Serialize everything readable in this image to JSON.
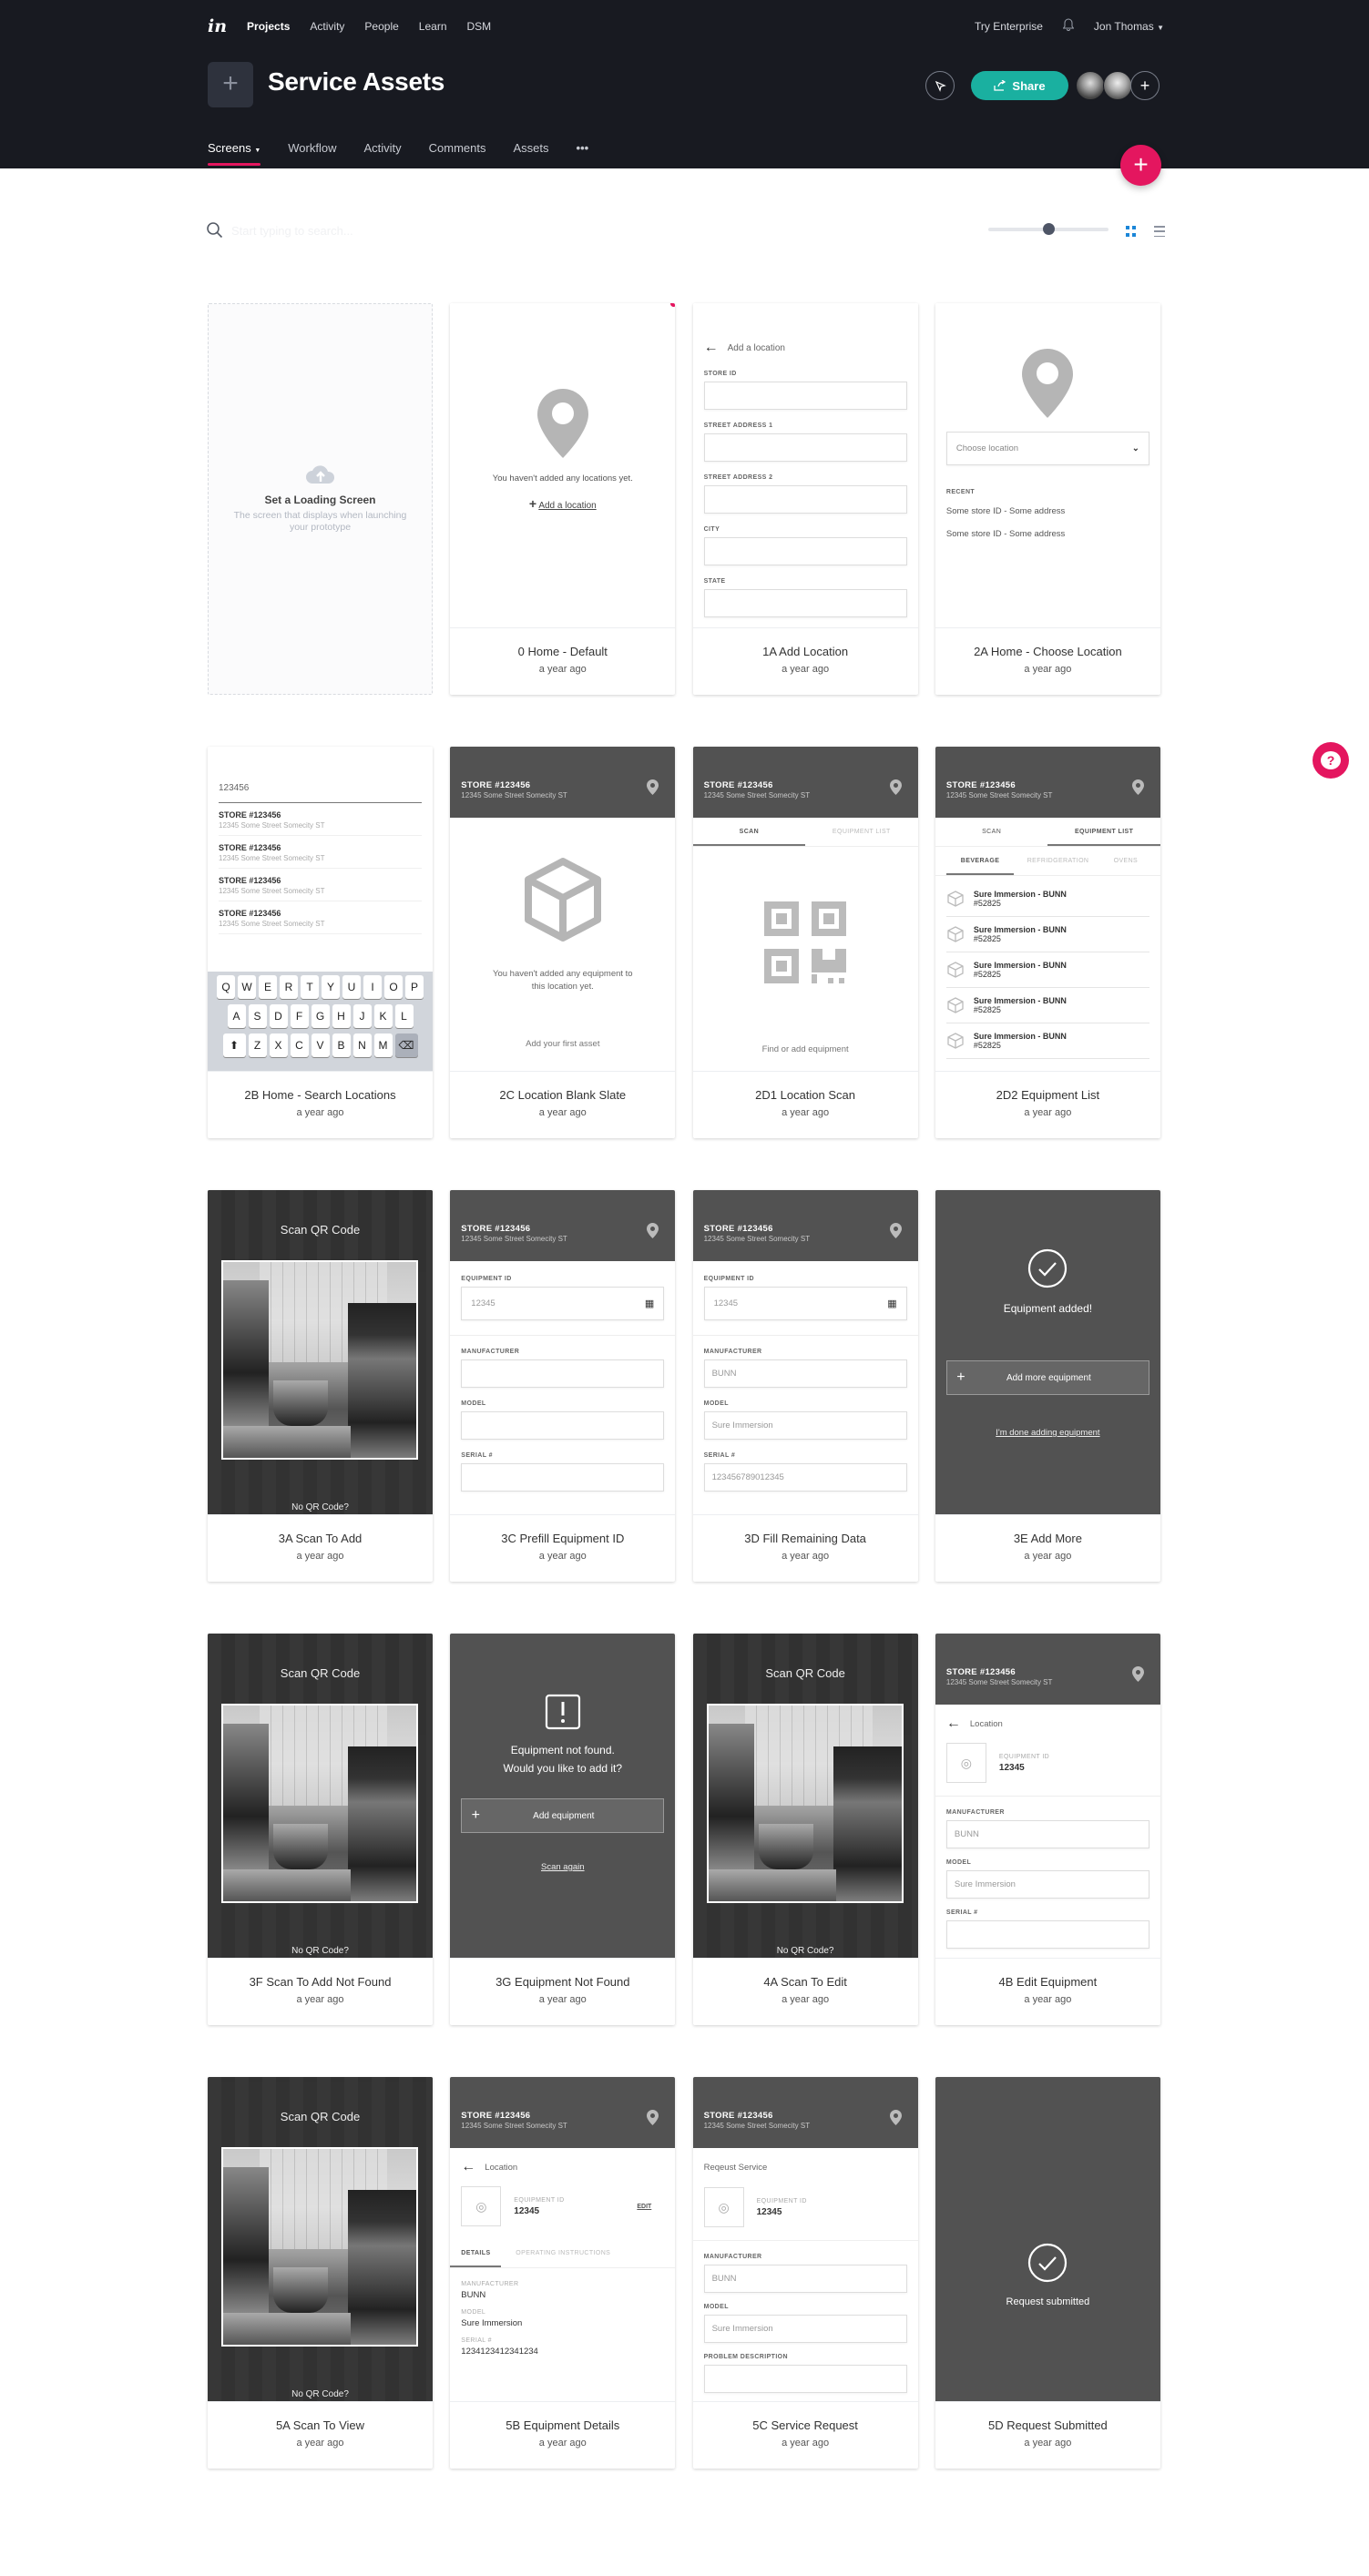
{
  "topnav": {
    "logo": "in",
    "items": [
      "Projects",
      "Activity",
      "People",
      "Learn",
      "DSM"
    ],
    "active": "Projects",
    "try_enterprise": "Try Enterprise",
    "user_name": "Jon Thomas"
  },
  "project": {
    "title": "Service Assets",
    "share_label": "Share"
  },
  "subnav": {
    "tabs": [
      "Screens",
      "Workflow",
      "Activity",
      "Comments",
      "Assets"
    ],
    "more": "•••"
  },
  "toolbar": {
    "search_placeholder": "Start typing to search...",
    "zoom_level": 0.5
  },
  "colors": {
    "accent": "#e4165f",
    "share": "#1ab0a0",
    "header_bg": "#181a21",
    "mock_dark": "#525252"
  },
  "loading_card": {
    "title": "Set a Loading Screen",
    "description": "The screen that displays when launching your prototype"
  },
  "common": {
    "time": "a year ago",
    "store_name": "STORE #123456",
    "store_address": "12345 Some Street Somecity ST",
    "scan_title": "Scan QR Code",
    "no_qr": "No QR Code?",
    "equipment_id_label": "EQUIPMENT ID",
    "equipment_id": "12345",
    "manufacturer_label": "MANUFACTURER",
    "model_label": "MODEL",
    "serial_label": "SERIAL #",
    "manufacturer": "BUNN",
    "model": "Sure Immersion"
  },
  "screens": [
    {
      "name": "0 Home - Default",
      "empty_text": "You haven't added any locations yet.",
      "link": "Add a location"
    },
    {
      "name": "1A Add Location",
      "back_label": "Add a location",
      "fields": [
        "STORE ID",
        "STREET ADDRESS 1",
        "STREET ADDRESS 2",
        "CITY",
        "STATE"
      ]
    },
    {
      "name": "2A Home - Choose Location",
      "select_placeholder": "Choose location",
      "recent_label": "RECENT",
      "recent": [
        "Some store ID - Some address",
        "Some store ID - Some address"
      ]
    },
    {
      "name": "2B Home - Search Locations",
      "query": "123456",
      "keyboard": [
        [
          "Q",
          "W",
          "E",
          "R",
          "T",
          "Y",
          "U",
          "I",
          "O",
          "P"
        ],
        [
          "A",
          "S",
          "D",
          "F",
          "G",
          "H",
          "J",
          "K",
          "L"
        ],
        [
          "Z",
          "X",
          "C",
          "V",
          "B",
          "N",
          "M"
        ]
      ]
    },
    {
      "name": "2C Location Blank Slate",
      "empty_text": "You haven't added any equipment to this location yet.",
      "cta": "Add your first asset"
    },
    {
      "name": "2D1 Location Scan",
      "tabs": [
        "SCAN",
        "EQUIPMENT LIST"
      ],
      "cta": "Find or add equipment"
    },
    {
      "name": "2D2 Equipment List",
      "tabs": [
        "SCAN",
        "EQUIPMENT LIST"
      ],
      "subtabs": [
        "BEVERAGE",
        "REFRIDGERATION",
        "OVENS"
      ],
      "item_title": "Sure Immersion - BUNN",
      "item_id": "#52825"
    },
    {
      "name": "3A Scan To Add"
    },
    {
      "name": "3C Prefill Equipment ID"
    },
    {
      "name": "3D Fill Remaining Data",
      "serial": "123456789012345"
    },
    {
      "name": "3E Add More",
      "message": "Equipment added!",
      "button": "Add more equipment",
      "link": "I'm done adding equipment"
    },
    {
      "name": "3F Scan To Add Not Found"
    },
    {
      "name": "3G Equipment Not Found",
      "message1": "Equipment not found.",
      "message2": "Would you like to add it?",
      "button": "Add equipment",
      "link": "Scan again"
    },
    {
      "name": "4A Scan To Edit"
    },
    {
      "name": "4B Edit Equipment",
      "back_label": "Location"
    },
    {
      "name": "5A Scan To View"
    },
    {
      "name": "5B Equipment Details",
      "back_label": "Location",
      "edit": "EDIT",
      "tabs": [
        "DETAILS",
        "OPERATING INSTRUCTIONS"
      ],
      "serial": "1234123412341234"
    },
    {
      "name": "5C Service Request",
      "title": "Reqeust Service",
      "problem_label": "PROBLEM DESCRIPTION"
    },
    {
      "name": "5D Request Submitted",
      "message": "Request submitted"
    }
  ]
}
